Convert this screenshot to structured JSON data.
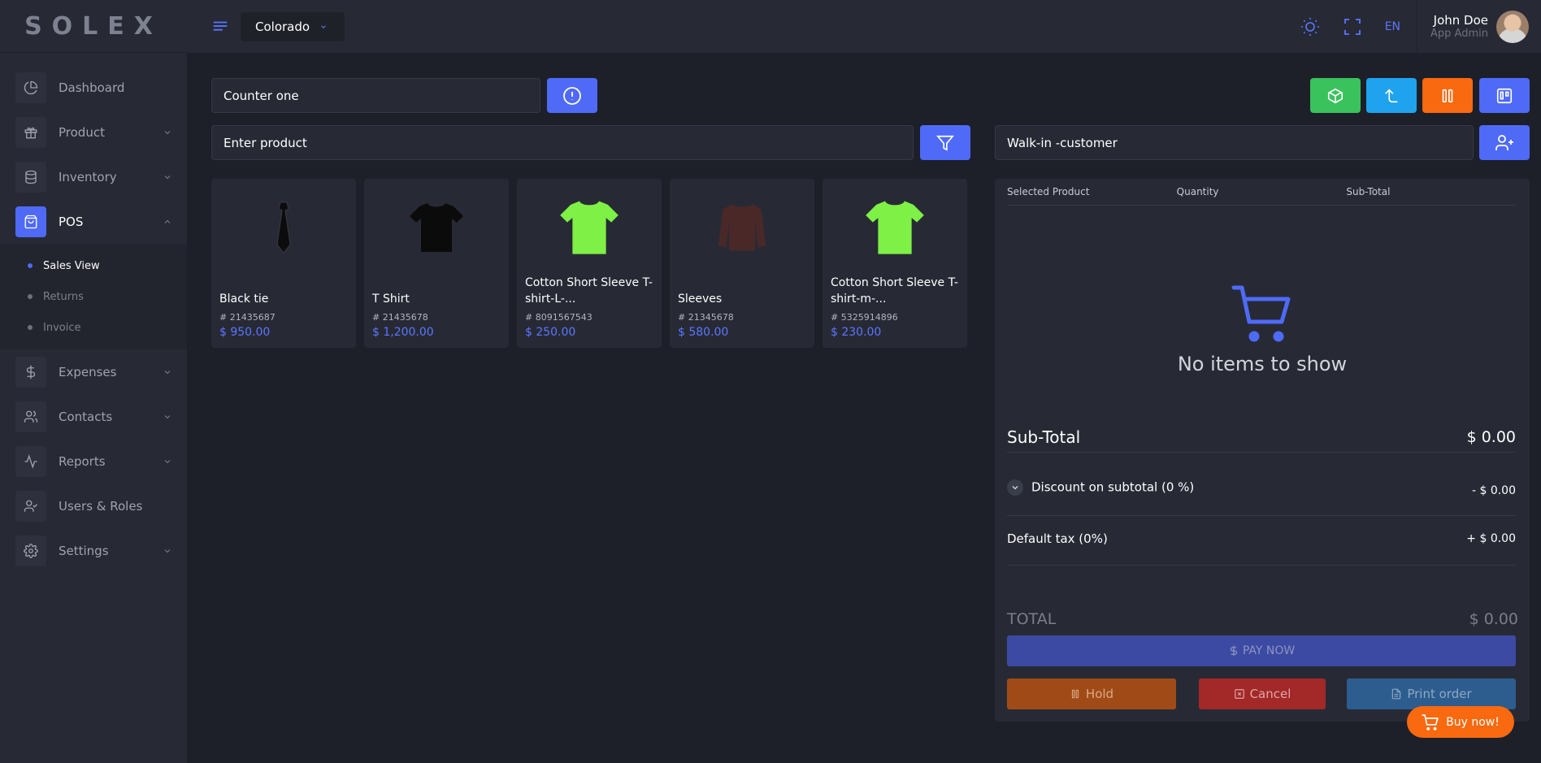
{
  "brand": {
    "logo": "SOLEX"
  },
  "header": {
    "location": "Colorado",
    "language": "EN",
    "user_name": "John Doe",
    "user_role": "App Admin"
  },
  "sidebar": {
    "items": [
      {
        "label": "Dashboard",
        "icon": "chart-pie-icon"
      },
      {
        "label": "Product",
        "icon": "gift-icon"
      },
      {
        "label": "Inventory",
        "icon": "database-icon"
      },
      {
        "label": "POS",
        "icon": "shopping-bag-icon"
      },
      {
        "label": "Expenses",
        "icon": "dollar-icon"
      },
      {
        "label": "Contacts",
        "icon": "users-icon"
      },
      {
        "label": "Reports",
        "icon": "activity-icon"
      },
      {
        "label": "Users & Roles",
        "icon": "user-check-icon"
      },
      {
        "label": "Settings",
        "icon": "gear-icon"
      }
    ],
    "pos_sub": [
      "Sales View",
      "Returns",
      "Invoice"
    ]
  },
  "pos": {
    "counter": "Counter one",
    "product_placeholder": "Enter product",
    "customer": "Walk-in -customer"
  },
  "products": [
    {
      "name": "Black tie",
      "sku": "# 21435687",
      "price": "$ 950.00"
    },
    {
      "name": "T Shirt",
      "sku": "# 21435678",
      "price": "$ 1,200.00"
    },
    {
      "name": "Cotton Short Sleeve T-shirt-L-...",
      "sku": "# 8091567543",
      "price": "$ 250.00"
    },
    {
      "name": "Sleeves",
      "sku": "# 21345678",
      "price": "$ 580.00"
    },
    {
      "name": "Cotton Short Sleeve T-shirt-m-...",
      "sku": "# 5325914896",
      "price": "$ 230.00"
    }
  ],
  "cart": {
    "columns": [
      "Selected Product",
      "Quantity",
      "Sub-Total"
    ],
    "empty_text": "No items to show",
    "subtotal_label": "Sub-Total",
    "subtotal_value": "$ 0.00",
    "discount_label": "Discount on subtotal (0 %)",
    "discount_value": "- $ 0.00",
    "tax_label": "Default tax (0%)",
    "tax_value": "+ $ 0.00",
    "total_label": "TOTAL",
    "total_value": "$ 0.00",
    "pay_label": "PAY NOW",
    "hold_label": "Hold",
    "cancel_label": "Cancel",
    "print_label": "Print order"
  },
  "buy_now": "Buy now!",
  "colors": {
    "accent": "#4e6af7",
    "green": "#3ac25c",
    "light_blue": "#1fa3ee",
    "orange": "#f9690f"
  }
}
